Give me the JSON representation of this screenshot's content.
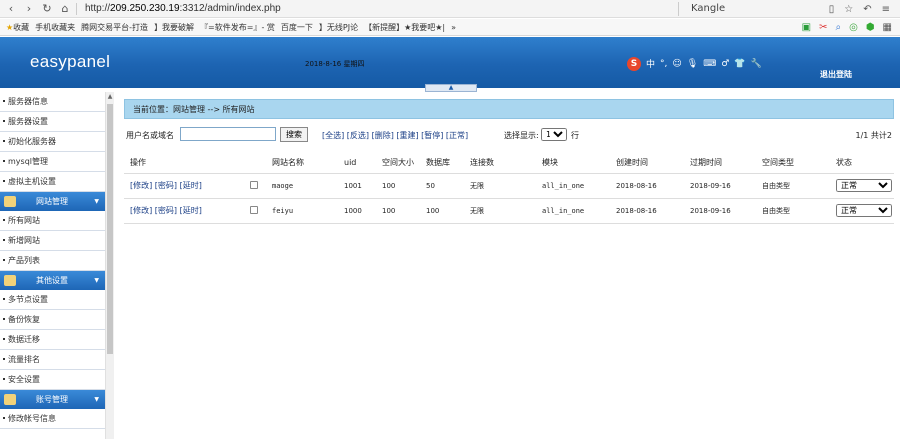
{
  "browser": {
    "url_prefix": "http://",
    "url_host": "209.250.230.19",
    "url_rest": ":3312/admin/index.php",
    "search_text": "Kangle",
    "bookmarks": [
      "收藏",
      "手机收藏夹",
      "腾网交易平台-打造",
      "】我要破解",
      "『=软件发布=』- 赏",
      "百度一下",
      "】无线PJ论",
      "【新提醒】★我要吧★|",
      "»"
    ]
  },
  "header": {
    "logo": "easypanel",
    "date": "2018-8-16 星期四",
    "toolbar_items": [
      "中",
      "°,",
      "☺",
      "🎙",
      "⌨",
      "♂",
      "👕",
      "🔧"
    ],
    "logout": "退出登陆",
    "toggle_glyph": "▲"
  },
  "sidebar": {
    "top_items": [
      "服务器信息",
      "服务器设置",
      "初始化服务器",
      "mysql管理",
      "虚拟主机设置"
    ],
    "sections": [
      {
        "title": "网站管理",
        "items": [
          "所有网站",
          "新增网站",
          "产品列表"
        ]
      },
      {
        "title": "其他设置",
        "items": [
          "多节点设置",
          "备份恢复",
          "数据迁移",
          "流量排名",
          "安全设置"
        ]
      },
      {
        "title": "账号管理",
        "items": [
          "修改帐号信息"
        ]
      }
    ],
    "arrow": "▼"
  },
  "main": {
    "breadcrumb": "当前位置：网站管理 --> 所有网站",
    "search_label": "用户名或域名",
    "search_value": "",
    "search_button": "搜索",
    "actions": "[全选] [反选] [删除] [重建] [暂停] [正常]",
    "page_size_label": "选择显示:",
    "page_size": "15",
    "row_label": "行",
    "pager": "1/1 共计2",
    "columns": [
      "操作",
      "",
      "网站名称",
      "uid",
      "空间大小",
      "数据库",
      "连接数",
      "模块",
      "创建时间",
      "过期时间",
      "空间类型",
      "状态"
    ],
    "rows": [
      {
        "ops": "[修改] [密码] [延时]",
        "name": "maoge",
        "uid": "1001",
        "space": "100",
        "db": "50",
        "conn": "无限",
        "module": "all_in_one",
        "created": "2018-08-16",
        "expires": "2018-09-16",
        "type": "自由类型",
        "status": "正常"
      },
      {
        "ops": "[修改] [密码] [延时]",
        "name": "feiyu",
        "uid": "1000",
        "space": "100",
        "db": "100",
        "conn": "无限",
        "module": "all_in_one",
        "created": "2018-08-16",
        "expires": "2018-09-16",
        "type": "自由类型",
        "status": "正常"
      }
    ]
  }
}
